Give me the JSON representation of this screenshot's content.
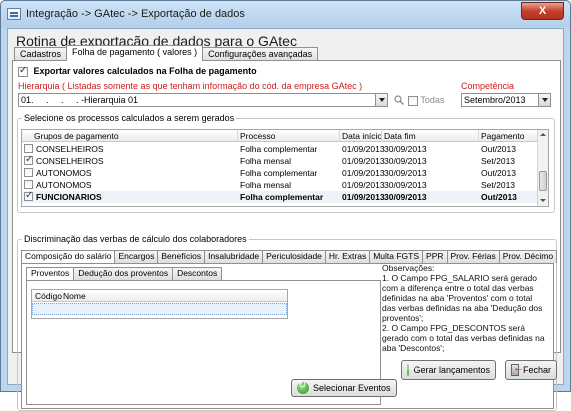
{
  "window": {
    "title": "Integração -> GAtec -> Exportação de dados",
    "close_label": "X"
  },
  "heading": "Rotina de exportação de dados para o GAtec",
  "tabs": [
    {
      "label": "Cadastros",
      "active": false
    },
    {
      "label": "Folha de pagamento ( valores )",
      "active": true
    },
    {
      "label": "Configurações avançadas",
      "active": false
    }
  ],
  "export_values": {
    "label": "Exportar valores calculados na Folha de pagamento",
    "checked": true
  },
  "hierarchy": {
    "label": "Hierarquia ( Listadas somente as que tenham informação do cód. da empresa GAtec )",
    "value": "01.     .     .     . -Hierarquia 01",
    "todas_label": "Todas"
  },
  "competencia": {
    "label": "Competência",
    "value": "Setembro/2013"
  },
  "processes": {
    "legend": "Selecione os processos calculados a serem gerados",
    "columns": [
      "Grupos de pagamento",
      "Processo",
      "Data início",
      "Data fim",
      "Pagamento"
    ],
    "rows": [
      {
        "checked": false,
        "grupo": "CONSELHEIROS",
        "processo": "Folha complementar",
        "inicio": "01/09/2013",
        "fim": "30/09/2013",
        "pagamento": "Out/2013",
        "selected": false
      },
      {
        "checked": true,
        "grupo": "CONSELHEIROS",
        "processo": "Folha mensal",
        "inicio": "01/09/2013",
        "fim": "30/09/2013",
        "pagamento": "Set/2013",
        "selected": false
      },
      {
        "checked": false,
        "grupo": "AUTONOMOS",
        "processo": "Folha complementar",
        "inicio": "01/09/2013",
        "fim": "30/09/2013",
        "pagamento": "Out/2013",
        "selected": false
      },
      {
        "checked": false,
        "grupo": "AUTONOMOS",
        "processo": "Folha mensal",
        "inicio": "01/09/2013",
        "fim": "30/09/2013",
        "pagamento": "Set/2013",
        "selected": false
      },
      {
        "checked": true,
        "grupo": "FUNCIONARIOS",
        "processo": "Folha complementar",
        "inicio": "01/09/2013",
        "fim": "30/09/2013",
        "pagamento": "Out/2013",
        "selected": true
      }
    ]
  },
  "verbas": {
    "legend": "Discriminação das verbas de cálculo dos colaboradores",
    "subtabs": [
      "Composição do salário",
      "Encargos",
      "Benefícios",
      "Insalubridade",
      "Periculosidade",
      "Hr. Extras",
      "Multa FGTS",
      "PPR",
      "Prov. Férias",
      "Prov. Décimo"
    ],
    "inner_tabs": [
      "Proventos",
      "Dedução dos proventos",
      "Descontos"
    ],
    "event_columns": [
      "Código",
      "Nome"
    ],
    "select_button": "Selecionar Eventos",
    "observations": [
      "Observações:",
      "1. O Campo FPG_SALARIO será gerado com a diferença entre o total das verbas definidas na aba 'Proventos' com o total das verbas definidas na aba 'Dedução dos proventos';",
      "2. O Campo FPG_DESCONTOS será gerado com o total das verbas definidas na aba 'Descontos';"
    ]
  },
  "footer": {
    "generate_button": "Gerar lançamentos",
    "close_button": "Fechar"
  },
  "colors": {
    "accent_red": "#d11b1b",
    "window_frame": "#bcd6ee"
  }
}
